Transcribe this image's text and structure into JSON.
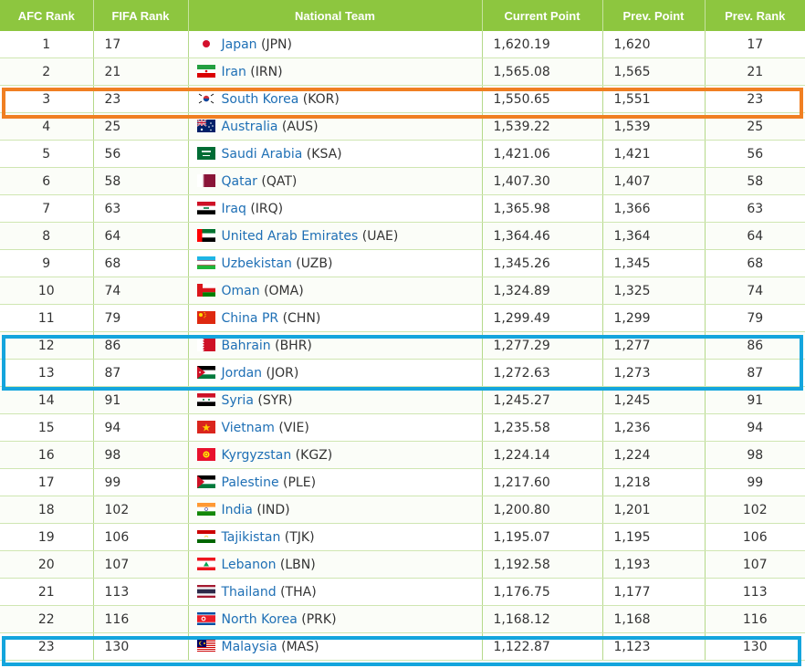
{
  "headers": [
    "AFC Rank",
    "FIFA Rank",
    "National Team",
    "Current Point",
    "Prev. Point",
    "Prev. Rank"
  ],
  "rows": [
    {
      "afc": "1",
      "fifa": "17",
      "team": "Japan",
      "code": "(JPN)",
      "current": "1,620.19",
      "prev_point": "1,620",
      "prev_rank": "17",
      "flag": "japan-flag-icon"
    },
    {
      "afc": "2",
      "fifa": "21",
      "team": "Iran",
      "code": "(IRN)",
      "current": "1,565.08",
      "prev_point": "1,565",
      "prev_rank": "21",
      "flag": "iran-flag-icon"
    },
    {
      "afc": "3",
      "fifa": "23",
      "team": "South Korea",
      "code": "(KOR)",
      "current": "1,550.65",
      "prev_point": "1,551",
      "prev_rank": "23",
      "flag": "south-korea-flag-icon"
    },
    {
      "afc": "4",
      "fifa": "25",
      "team": "Australia",
      "code": "(AUS)",
      "current": "1,539.22",
      "prev_point": "1,539",
      "prev_rank": "25",
      "flag": "australia-flag-icon"
    },
    {
      "afc": "5",
      "fifa": "56",
      "team": "Saudi Arabia",
      "code": "(KSA)",
      "current": "1,421.06",
      "prev_point": "1,421",
      "prev_rank": "56",
      "flag": "saudi-arabia-flag-icon"
    },
    {
      "afc": "6",
      "fifa": "58",
      "team": "Qatar",
      "code": "(QAT)",
      "current": "1,407.30",
      "prev_point": "1,407",
      "prev_rank": "58",
      "flag": "qatar-flag-icon"
    },
    {
      "afc": "7",
      "fifa": "63",
      "team": "Iraq",
      "code": "(IRQ)",
      "current": "1,365.98",
      "prev_point": "1,366",
      "prev_rank": "63",
      "flag": "iraq-flag-icon"
    },
    {
      "afc": "8",
      "fifa": "64",
      "team": "United Arab Emirates",
      "code": "(UAE)",
      "current": "1,364.46",
      "prev_point": "1,364",
      "prev_rank": "64",
      "flag": "uae-flag-icon"
    },
    {
      "afc": "9",
      "fifa": "68",
      "team": "Uzbekistan",
      "code": "(UZB)",
      "current": "1,345.26",
      "prev_point": "1,345",
      "prev_rank": "68",
      "flag": "uzbekistan-flag-icon"
    },
    {
      "afc": "10",
      "fifa": "74",
      "team": "Oman",
      "code": "(OMA)",
      "current": "1,324.89",
      "prev_point": "1,325",
      "prev_rank": "74",
      "flag": "oman-flag-icon"
    },
    {
      "afc": "11",
      "fifa": "79",
      "team": "China PR",
      "code": "(CHN)",
      "current": "1,299.49",
      "prev_point": "1,299",
      "prev_rank": "79",
      "flag": "china-flag-icon"
    },
    {
      "afc": "12",
      "fifa": "86",
      "team": "Bahrain",
      "code": "(BHR)",
      "current": "1,277.29",
      "prev_point": "1,277",
      "prev_rank": "86",
      "flag": "bahrain-flag-icon"
    },
    {
      "afc": "13",
      "fifa": "87",
      "team": "Jordan",
      "code": "(JOR)",
      "current": "1,272.63",
      "prev_point": "1,273",
      "prev_rank": "87",
      "flag": "jordan-flag-icon"
    },
    {
      "afc": "14",
      "fifa": "91",
      "team": "Syria",
      "code": "(SYR)",
      "current": "1,245.27",
      "prev_point": "1,245",
      "prev_rank": "91",
      "flag": "syria-flag-icon"
    },
    {
      "afc": "15",
      "fifa": "94",
      "team": "Vietnam",
      "code": "(VIE)",
      "current": "1,235.58",
      "prev_point": "1,236",
      "prev_rank": "94",
      "flag": "vietnam-flag-icon"
    },
    {
      "afc": "16",
      "fifa": "98",
      "team": "Kyrgyzstan",
      "code": "(KGZ)",
      "current": "1,224.14",
      "prev_point": "1,224",
      "prev_rank": "98",
      "flag": "kyrgyzstan-flag-icon"
    },
    {
      "afc": "17",
      "fifa": "99",
      "team": "Palestine",
      "code": "(PLE)",
      "current": "1,217.60",
      "prev_point": "1,218",
      "prev_rank": "99",
      "flag": "palestine-flag-icon"
    },
    {
      "afc": "18",
      "fifa": "102",
      "team": "India",
      "code": "(IND)",
      "current": "1,200.80",
      "prev_point": "1,201",
      "prev_rank": "102",
      "flag": "india-flag-icon"
    },
    {
      "afc": "19",
      "fifa": "106",
      "team": "Tajikistan",
      "code": "(TJK)",
      "current": "1,195.07",
      "prev_point": "1,195",
      "prev_rank": "106",
      "flag": "tajikistan-flag-icon"
    },
    {
      "afc": "20",
      "fifa": "107",
      "team": "Lebanon",
      "code": "(LBN)",
      "current": "1,192.58",
      "prev_point": "1,193",
      "prev_rank": "107",
      "flag": "lebanon-flag-icon"
    },
    {
      "afc": "21",
      "fifa": "113",
      "team": "Thailand",
      "code": "(THA)",
      "current": "1,176.75",
      "prev_point": "1,177",
      "prev_rank": "113",
      "flag": "thailand-flag-icon"
    },
    {
      "afc": "22",
      "fifa": "116",
      "team": "North Korea",
      "code": "(PRK)",
      "current": "1,168.12",
      "prev_point": "1,168",
      "prev_rank": "116",
      "flag": "north-korea-flag-icon"
    },
    {
      "afc": "23",
      "fifa": "130",
      "team": "Malaysia",
      "code": "(MAS)",
      "current": "1,122.87",
      "prev_point": "1,123",
      "prev_rank": "130",
      "flag": "malaysia-flag-icon"
    }
  ],
  "highlights": [
    {
      "rows": "3",
      "color": "#f07f22"
    },
    {
      "rows": "12-13",
      "color": "#14a5dd"
    },
    {
      "rows": "23",
      "color": "#14a5dd"
    }
  ],
  "colors": {
    "header_bg": "#8dc63f",
    "link": "#1e6fb5",
    "grid": "#b5d98a"
  }
}
